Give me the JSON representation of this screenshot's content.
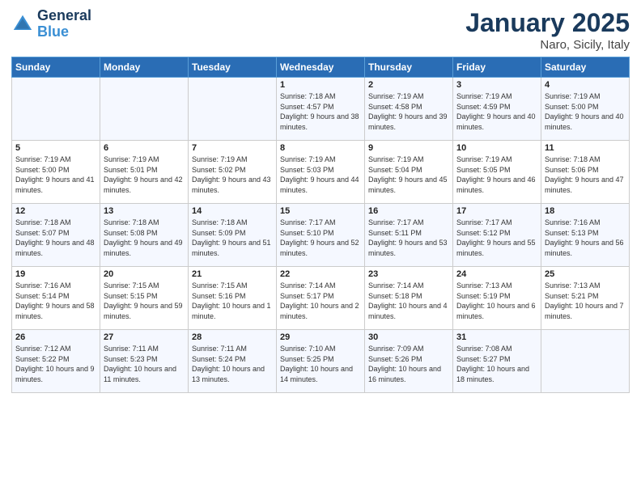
{
  "logo": {
    "line1": "General",
    "line2": "Blue"
  },
  "title": "January 2025",
  "subtitle": "Naro, Sicily, Italy",
  "days_header": [
    "Sunday",
    "Monday",
    "Tuesday",
    "Wednesday",
    "Thursday",
    "Friday",
    "Saturday"
  ],
  "weeks": [
    [
      {
        "num": "",
        "content": ""
      },
      {
        "num": "",
        "content": ""
      },
      {
        "num": "",
        "content": ""
      },
      {
        "num": "1",
        "content": "Sunrise: 7:18 AM\nSunset: 4:57 PM\nDaylight: 9 hours\nand 38 minutes."
      },
      {
        "num": "2",
        "content": "Sunrise: 7:19 AM\nSunset: 4:58 PM\nDaylight: 9 hours\nand 39 minutes."
      },
      {
        "num": "3",
        "content": "Sunrise: 7:19 AM\nSunset: 4:59 PM\nDaylight: 9 hours\nand 40 minutes."
      },
      {
        "num": "4",
        "content": "Sunrise: 7:19 AM\nSunset: 5:00 PM\nDaylight: 9 hours\nand 40 minutes."
      }
    ],
    [
      {
        "num": "5",
        "content": "Sunrise: 7:19 AM\nSunset: 5:00 PM\nDaylight: 9 hours\nand 41 minutes."
      },
      {
        "num": "6",
        "content": "Sunrise: 7:19 AM\nSunset: 5:01 PM\nDaylight: 9 hours\nand 42 minutes."
      },
      {
        "num": "7",
        "content": "Sunrise: 7:19 AM\nSunset: 5:02 PM\nDaylight: 9 hours\nand 43 minutes."
      },
      {
        "num": "8",
        "content": "Sunrise: 7:19 AM\nSunset: 5:03 PM\nDaylight: 9 hours\nand 44 minutes."
      },
      {
        "num": "9",
        "content": "Sunrise: 7:19 AM\nSunset: 5:04 PM\nDaylight: 9 hours\nand 45 minutes."
      },
      {
        "num": "10",
        "content": "Sunrise: 7:19 AM\nSunset: 5:05 PM\nDaylight: 9 hours\nand 46 minutes."
      },
      {
        "num": "11",
        "content": "Sunrise: 7:18 AM\nSunset: 5:06 PM\nDaylight: 9 hours\nand 47 minutes."
      }
    ],
    [
      {
        "num": "12",
        "content": "Sunrise: 7:18 AM\nSunset: 5:07 PM\nDaylight: 9 hours\nand 48 minutes."
      },
      {
        "num": "13",
        "content": "Sunrise: 7:18 AM\nSunset: 5:08 PM\nDaylight: 9 hours\nand 49 minutes."
      },
      {
        "num": "14",
        "content": "Sunrise: 7:18 AM\nSunset: 5:09 PM\nDaylight: 9 hours\nand 51 minutes."
      },
      {
        "num": "15",
        "content": "Sunrise: 7:17 AM\nSunset: 5:10 PM\nDaylight: 9 hours\nand 52 minutes."
      },
      {
        "num": "16",
        "content": "Sunrise: 7:17 AM\nSunset: 5:11 PM\nDaylight: 9 hours\nand 53 minutes."
      },
      {
        "num": "17",
        "content": "Sunrise: 7:17 AM\nSunset: 5:12 PM\nDaylight: 9 hours\nand 55 minutes."
      },
      {
        "num": "18",
        "content": "Sunrise: 7:16 AM\nSunset: 5:13 PM\nDaylight: 9 hours\nand 56 minutes."
      }
    ],
    [
      {
        "num": "19",
        "content": "Sunrise: 7:16 AM\nSunset: 5:14 PM\nDaylight: 9 hours\nand 58 minutes."
      },
      {
        "num": "20",
        "content": "Sunrise: 7:15 AM\nSunset: 5:15 PM\nDaylight: 9 hours\nand 59 minutes."
      },
      {
        "num": "21",
        "content": "Sunrise: 7:15 AM\nSunset: 5:16 PM\nDaylight: 10 hours\nand 1 minute."
      },
      {
        "num": "22",
        "content": "Sunrise: 7:14 AM\nSunset: 5:17 PM\nDaylight: 10 hours\nand 2 minutes."
      },
      {
        "num": "23",
        "content": "Sunrise: 7:14 AM\nSunset: 5:18 PM\nDaylight: 10 hours\nand 4 minutes."
      },
      {
        "num": "24",
        "content": "Sunrise: 7:13 AM\nSunset: 5:19 PM\nDaylight: 10 hours\nand 6 minutes."
      },
      {
        "num": "25",
        "content": "Sunrise: 7:13 AM\nSunset: 5:21 PM\nDaylight: 10 hours\nand 7 minutes."
      }
    ],
    [
      {
        "num": "26",
        "content": "Sunrise: 7:12 AM\nSunset: 5:22 PM\nDaylight: 10 hours\nand 9 minutes."
      },
      {
        "num": "27",
        "content": "Sunrise: 7:11 AM\nSunset: 5:23 PM\nDaylight: 10 hours\nand 11 minutes."
      },
      {
        "num": "28",
        "content": "Sunrise: 7:11 AM\nSunset: 5:24 PM\nDaylight: 10 hours\nand 13 minutes."
      },
      {
        "num": "29",
        "content": "Sunrise: 7:10 AM\nSunset: 5:25 PM\nDaylight: 10 hours\nand 14 minutes."
      },
      {
        "num": "30",
        "content": "Sunrise: 7:09 AM\nSunset: 5:26 PM\nDaylight: 10 hours\nand 16 minutes."
      },
      {
        "num": "31",
        "content": "Sunrise: 7:08 AM\nSunset: 5:27 PM\nDaylight: 10 hours\nand 18 minutes."
      },
      {
        "num": "",
        "content": ""
      }
    ]
  ]
}
